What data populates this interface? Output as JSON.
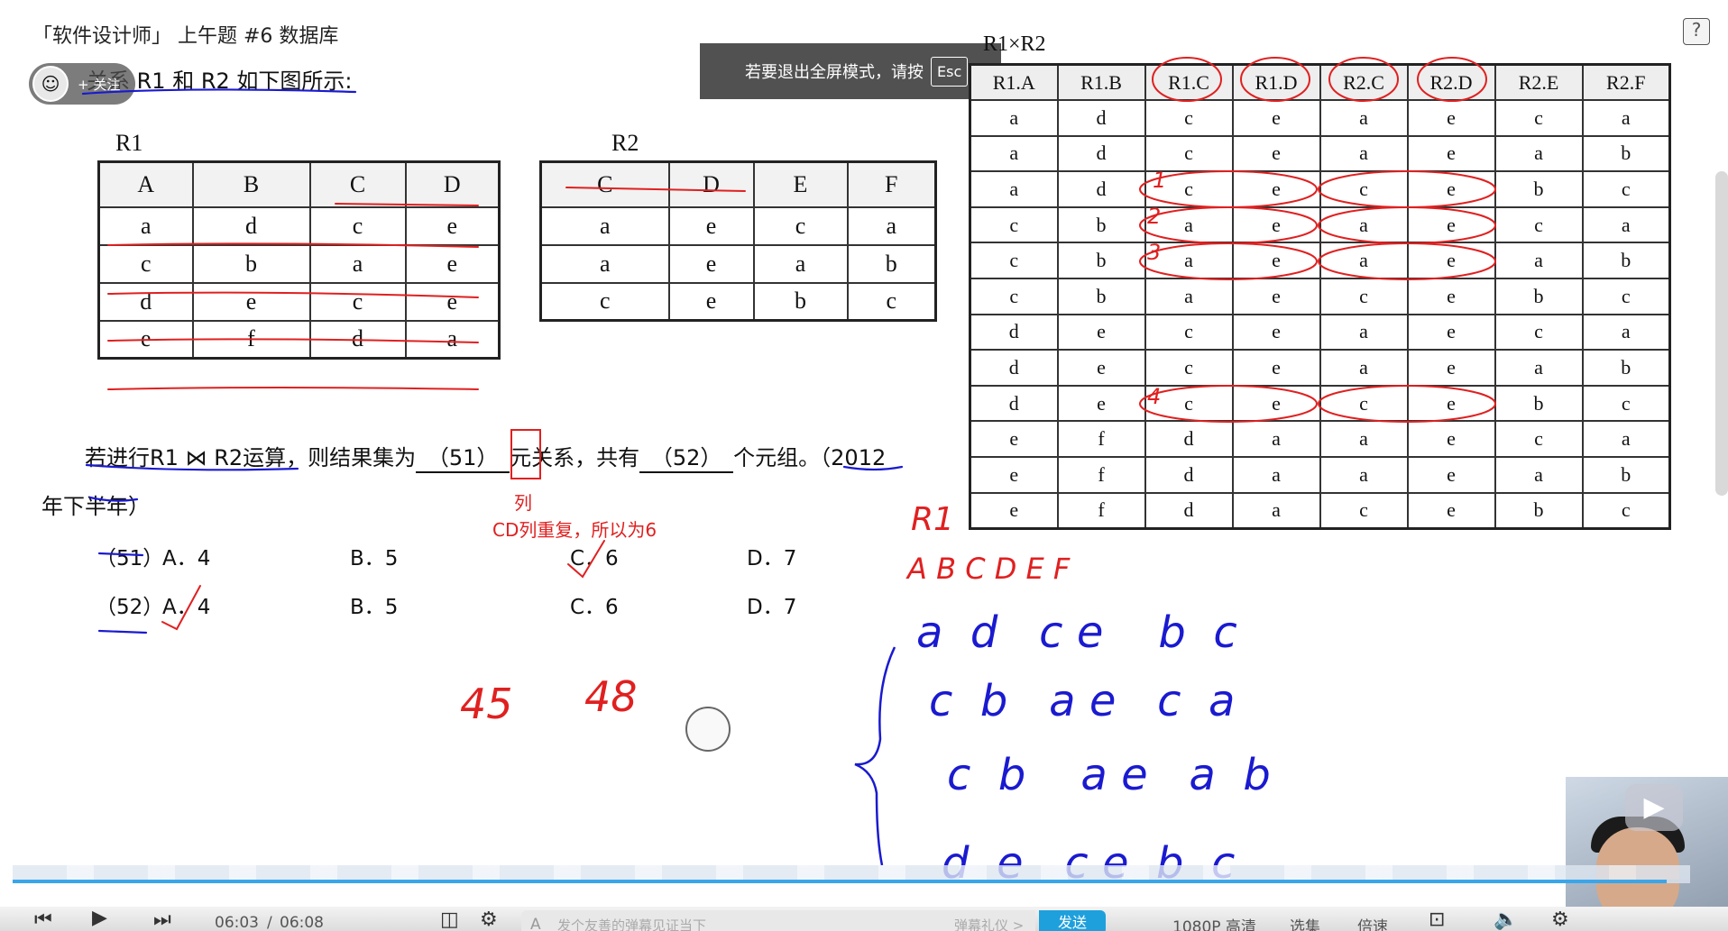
{
  "header": {
    "video_title": "「软件设计师」 上午题 #6 数据库",
    "follow_button": "+ 关注",
    "intro_text": "关系 R1 和 R2 如下图所示:",
    "fullscreen_toast": "若要退出全屏模式，请按",
    "esc_key": "Esc"
  },
  "r1": {
    "title": "R1",
    "headers": [
      "A",
      "B",
      "C",
      "D"
    ],
    "rows": [
      [
        "a",
        "d",
        "c",
        "e"
      ],
      [
        "c",
        "b",
        "a",
        "e"
      ],
      [
        "d",
        "e",
        "c",
        "e"
      ],
      [
        "e",
        "f",
        "d",
        "a"
      ]
    ]
  },
  "r2": {
    "title": "R2",
    "headers": [
      "C",
      "D",
      "E",
      "F"
    ],
    "rows": [
      [
        "a",
        "e",
        "c",
        "a"
      ],
      [
        "a",
        "e",
        "a",
        "b"
      ],
      [
        "c",
        "e",
        "b",
        "c"
      ]
    ]
  },
  "cross": {
    "title": "R1×R2",
    "headers": [
      "R1.A",
      "R1.B",
      "R1.C",
      "R1.D",
      "R2.C",
      "R2.D",
      "R2.E",
      "R2.F"
    ],
    "rows": [
      [
        "a",
        "d",
        "c",
        "e",
        "a",
        "e",
        "c",
        "a"
      ],
      [
        "a",
        "d",
        "c",
        "e",
        "a",
        "e",
        "a",
        "b"
      ],
      [
        "a",
        "d",
        "c",
        "e",
        "c",
        "e",
        "b",
        "c"
      ],
      [
        "c",
        "b",
        "a",
        "e",
        "a",
        "e",
        "c",
        "a"
      ],
      [
        "c",
        "b",
        "a",
        "e",
        "a",
        "e",
        "a",
        "b"
      ],
      [
        "c",
        "b",
        "a",
        "e",
        "c",
        "e",
        "b",
        "c"
      ],
      [
        "d",
        "e",
        "c",
        "e",
        "a",
        "e",
        "c",
        "a"
      ],
      [
        "d",
        "e",
        "c",
        "e",
        "a",
        "e",
        "a",
        "b"
      ],
      [
        "d",
        "e",
        "c",
        "e",
        "c",
        "e",
        "b",
        "c"
      ],
      [
        "e",
        "f",
        "d",
        "a",
        "a",
        "e",
        "c",
        "a"
      ],
      [
        "e",
        "f",
        "d",
        "a",
        "a",
        "e",
        "a",
        "b"
      ],
      [
        "e",
        "f",
        "d",
        "a",
        "c",
        "e",
        "b",
        "c"
      ]
    ]
  },
  "question": {
    "part1": "若进行R1 ⋈ R2运算，则结果集为",
    "blank51": "（51）",
    "part2": "元关系，共有",
    "blank52": "（52）",
    "part3": "个元组。（2012",
    "line2": "年下半年）",
    "annot_col": "列",
    "annot_reason": "CD列重复，所以为6"
  },
  "options": [
    {
      "num": "（51）",
      "a": "A．4",
      "b": "B．5",
      "c": "C．6",
      "d": "D．7"
    },
    {
      "num": "（52）",
      "a": "A．4",
      "b": "B．5",
      "c": "C．6",
      "d": "D．7"
    }
  ],
  "handwriting": {
    "red_numbers": [
      "4",
      "1",
      "2",
      "3"
    ],
    "red_calc_1": "45",
    "red_calc_2": "48",
    "result_title": "R1",
    "result_headers": "A   B   C   D   E   F",
    "result_rows": [
      "a  d   c e    b  c",
      "c  b   a e   c  a",
      "c  b    a e   a  b",
      "d  e   c e  b  c"
    ]
  },
  "player": {
    "time_current": "06:03",
    "time_sep": "/",
    "time_total": "06:08",
    "danmu_placeholder": "发个友善的弹幕见证当下",
    "danmu_etiquette": "弹幕礼仪 >",
    "send": "发送",
    "quality": "1080P 高清",
    "episodes": "选集",
    "speed": "倍速",
    "progress_fraction": 0.986,
    "accent_color": "#1ea0dc"
  }
}
